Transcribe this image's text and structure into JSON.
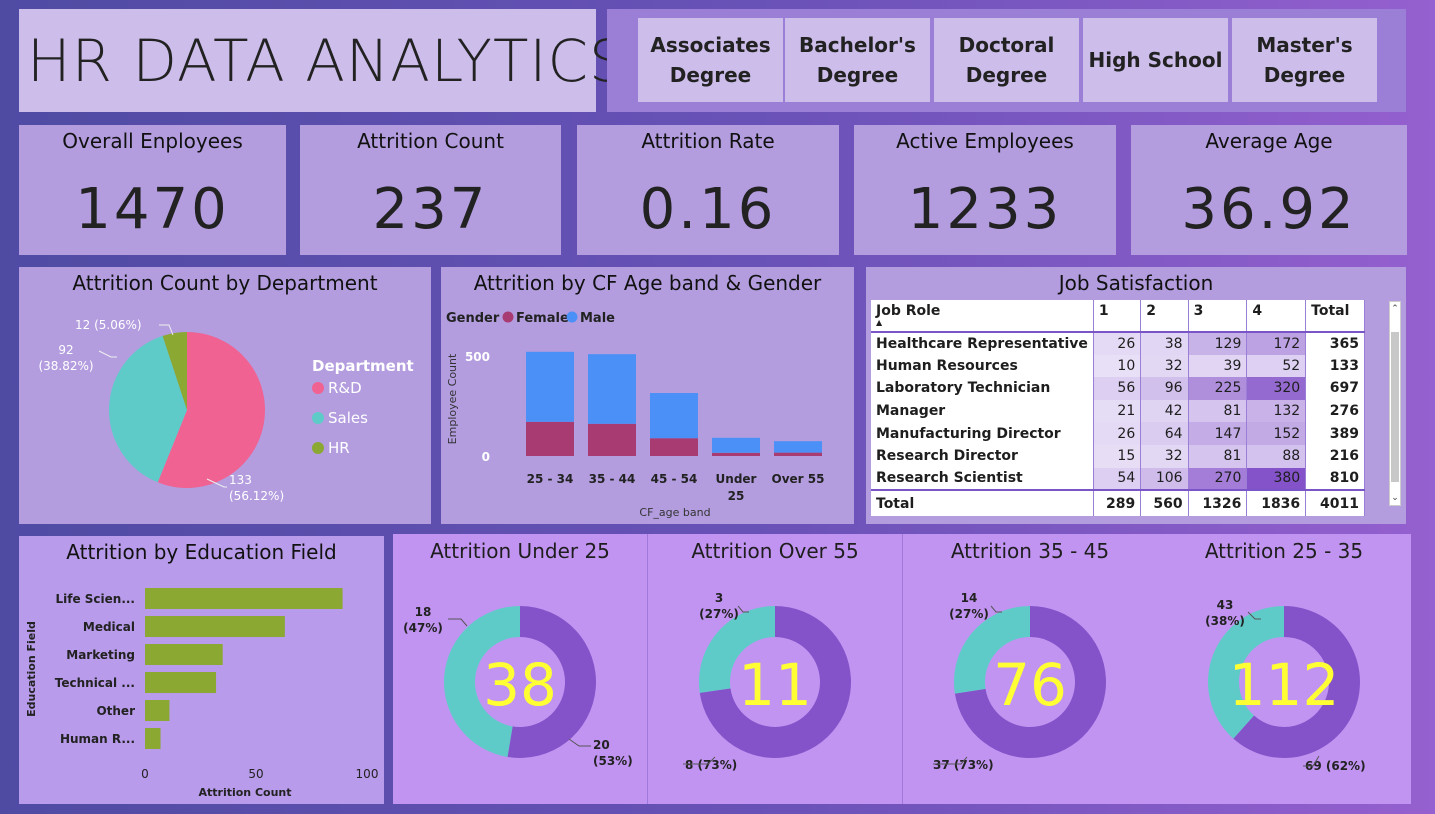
{
  "title": "HR DATA ANALYTICS",
  "slicer": [
    "Associates\nDegree",
    "Bachelor's\nDegree",
    "Doctoral\nDegree",
    "High School",
    "Master's\nDegree"
  ],
  "kpis": [
    {
      "label": "Overall Enployees",
      "value": "1470"
    },
    {
      "label": "Attrition Count",
      "value": "237"
    },
    {
      "label": "Attrition Rate",
      "value": "0.16"
    },
    {
      "label": "Active Employees",
      "value": "1233"
    },
    {
      "label": "Average Age",
      "value": "36.92"
    }
  ],
  "colors": {
    "rnd": "#f06292",
    "sales": "#5ecbc8",
    "hr": "#8aa832",
    "female": "#a73b72",
    "male": "#4a90f7",
    "donut": "#8553c9",
    "donut_center": "#ffff33"
  },
  "job_satisfaction": {
    "title": "Job Satisfaction",
    "headers": [
      "Job Role",
      "1",
      "2",
      "3",
      "4",
      "Total"
    ],
    "rows": [
      [
        "Healthcare Representative",
        "26",
        "38",
        "129",
        "172",
        "365"
      ],
      [
        "Human Resources",
        "10",
        "32",
        "39",
        "52",
        "133"
      ],
      [
        "Laboratory Technician",
        "56",
        "96",
        "225",
        "320",
        "697"
      ],
      [
        "Manager",
        "21",
        "42",
        "81",
        "132",
        "276"
      ],
      [
        "Manufacturing Director",
        "26",
        "64",
        "147",
        "152",
        "389"
      ],
      [
        "Research Director",
        "15",
        "32",
        "81",
        "88",
        "216"
      ],
      [
        "Research Scientist",
        "54",
        "106",
        "270",
        "380",
        "810"
      ]
    ],
    "total": [
      "Total",
      "289",
      "560",
      "1326",
      "1836",
      "4011"
    ]
  },
  "chart_data": [
    {
      "type": "pie",
      "title": "Attrition Count by Department",
      "legend_title": "Department",
      "slices": [
        {
          "name": "R&D",
          "value": 133,
          "label": "133\n(56.12%)"
        },
        {
          "name": "Sales",
          "value": 92,
          "label": "92\n(38.82%)"
        },
        {
          "name": "HR",
          "value": 12,
          "label": "12 (5.06%)"
        }
      ]
    },
    {
      "type": "bar",
      "stacked": true,
      "title": "Attrition by CF Age band & Gender",
      "legend_title": "Gender",
      "categories": [
        "25 - 34",
        "35 - 44",
        "45 - 54",
        "Under\n25",
        "Over 55"
      ],
      "series": [
        {
          "name": "Female",
          "values": [
            171,
            161,
            89,
            16,
            17
          ]
        },
        {
          "name": "Male",
          "values": [
            350,
            348,
            226,
            75,
            57
          ]
        }
      ],
      "xlabel": "CF_age band",
      "ylabel": "Employee Count",
      "yticks": [
        "0",
        "500"
      ],
      "ylim": [
        0,
        640
      ]
    },
    {
      "type": "bar",
      "orientation": "horizontal",
      "title": "Attrition by Education Field",
      "categories": [
        "Life Scien...",
        "Medical",
        "Marketing",
        "Technical ...",
        "Other",
        "Human R..."
      ],
      "values": [
        89,
        63,
        35,
        32,
        11,
        7
      ],
      "xlabel": "Attrition Count",
      "ylabel": "Education Field",
      "xticks": [
        "0",
        "50",
        "100"
      ],
      "xlim": [
        0,
        100
      ]
    },
    {
      "type": "pie",
      "donut": true,
      "title": "Attrition Under 25",
      "center": "38",
      "slices": [
        {
          "value": 20,
          "label": "20\n(53%)"
        },
        {
          "value": 18,
          "label": "18\n(47%)"
        }
      ]
    },
    {
      "type": "pie",
      "donut": true,
      "title": "Attrition Over 55",
      "center": "11",
      "slices": [
        {
          "value": 8,
          "label": "8 (73%)"
        },
        {
          "value": 3,
          "label": "3\n(27%)"
        }
      ]
    },
    {
      "type": "pie",
      "donut": true,
      "title": "Attrition 35 - 45",
      "center": "76",
      "slices": [
        {
          "value": 37,
          "label": "37 (73%)"
        },
        {
          "value": 14,
          "label": "14\n(27%)"
        }
      ]
    },
    {
      "type": "pie",
      "donut": true,
      "title": "Attrition 25 - 35",
      "center": "112",
      "slices": [
        {
          "value": 69,
          "label": "69 (62%)"
        },
        {
          "value": 43,
          "label": "43\n(38%)"
        }
      ]
    }
  ]
}
